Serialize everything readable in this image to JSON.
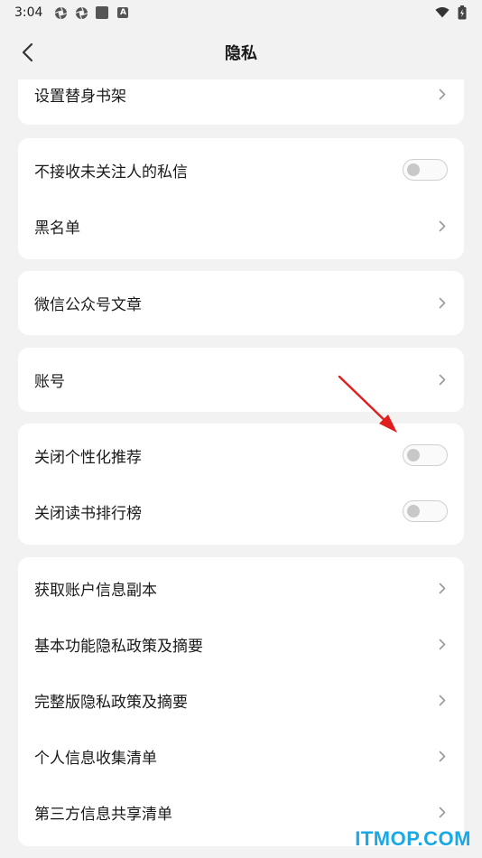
{
  "status_bar": {
    "time": "3:04"
  },
  "header": {
    "title": "隐私"
  },
  "sections": {
    "s1": {
      "item0": "设置替身书架"
    },
    "s2": {
      "item0": "不接收未关注人的私信",
      "item1": "黑名单"
    },
    "s3": {
      "item0": "微信公众号文章"
    },
    "s4": {
      "item0": "账号"
    },
    "s5": {
      "item0": "关闭个性化推荐",
      "item1": "关闭读书排行榜"
    },
    "s6": {
      "item0": "获取账户信息副本",
      "item1": "基本功能隐私政策及摘要",
      "item2": "完整版隐私政策及摘要",
      "item3": "个人信息收集清单",
      "item4": "第三方信息共享清单"
    }
  },
  "toggles": {
    "private_messages": false,
    "personalized_recommendation": false,
    "reading_ranking": false
  },
  "watermark": "ITMOP.COM",
  "colors": {
    "background": "#f2f2f2",
    "card": "#ffffff",
    "annotation_arrow": "#e01e1e",
    "watermark": "#1aa9e6"
  }
}
